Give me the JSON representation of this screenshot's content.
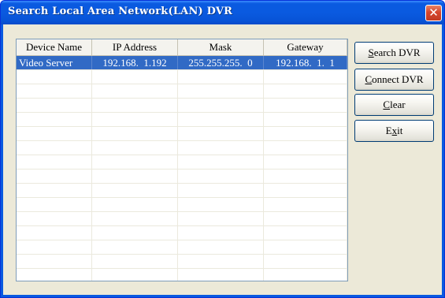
{
  "window": {
    "title": "Search Local Area Network(LAN) DVR",
    "close_glyph": "✕"
  },
  "list": {
    "columns": [
      "Device Name",
      "IP Address",
      "Mask",
      "Gateway"
    ],
    "rows": [
      {
        "device_name": "Video Server",
        "ip_address": "192.168.  1.192",
        "mask": "255.255.255.  0",
        "gateway": "192.168.  1.  1",
        "selected": true
      }
    ],
    "empty_row_count": 15
  },
  "buttons": {
    "search": {
      "before": "",
      "key": "S",
      "after": "earch DVR"
    },
    "connect": {
      "before": "",
      "key": "C",
      "after": "onnect DVR"
    },
    "clear": {
      "before": "",
      "key": "C",
      "after": "lear"
    },
    "exit": {
      "before": "E",
      "key": "x",
      "after": "it"
    }
  },
  "colors": {
    "title_bar": "#0a5ae0",
    "selection": "#316ac5",
    "close_button": "#d6452d"
  }
}
